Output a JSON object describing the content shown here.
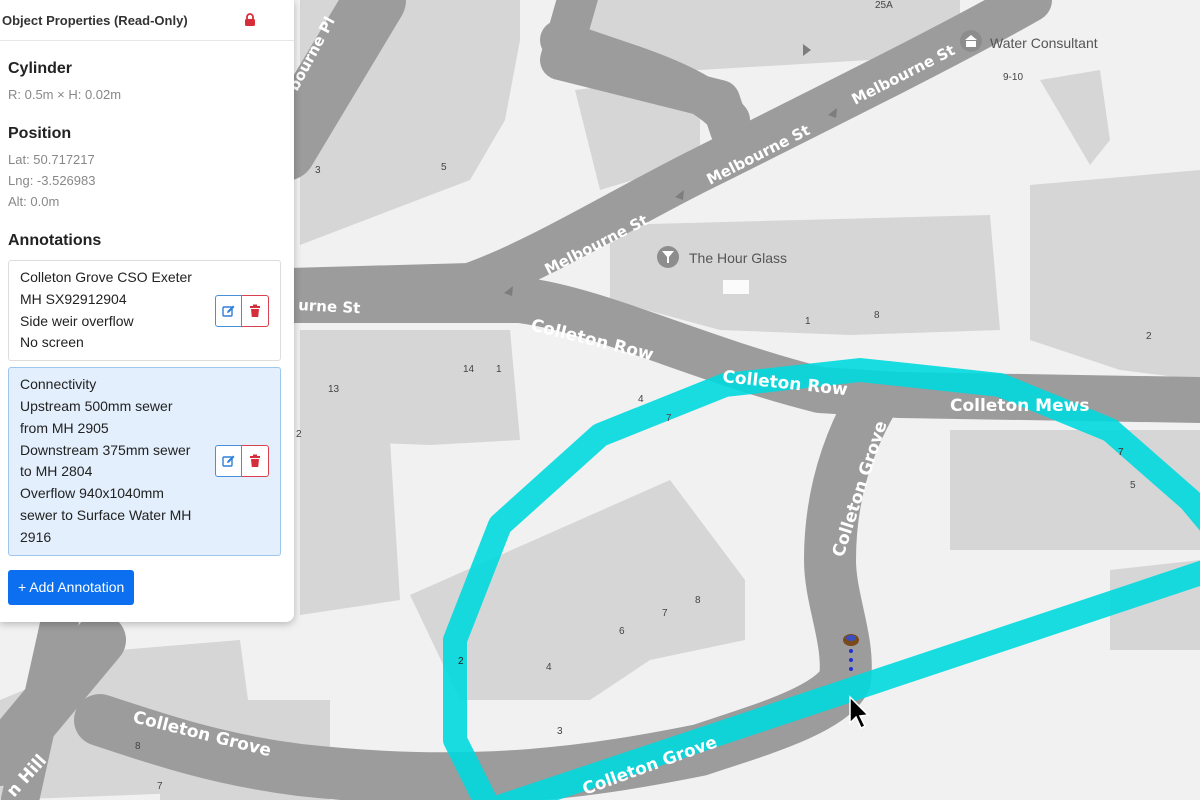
{
  "panel": {
    "title": "Object Properties (Read-Only)",
    "lock_icon": "lock-icon",
    "shape": {
      "heading": "Cylinder",
      "dimensions": "R: 0.5m × H: 0.02m"
    },
    "position": {
      "heading": "Position",
      "lat": "Lat: 50.717217",
      "lng": "Lng: -3.526983",
      "alt": "Alt: 0.0m"
    },
    "annotations_heading": "Annotations",
    "annotations": [
      {
        "lines": [
          "Colleton Grove CSO Exeter",
          "MH SX92912904",
          "Side weir overflow",
          "No screen"
        ]
      },
      {
        "lines": [
          "Connectivity",
          "Upstream 500mm sewer",
          "from MH 2905",
          "Downstream 375mm sewer",
          "to MH 2804",
          "Overflow 940x1040mm",
          "sewer to Surface Water MH",
          "2916"
        ]
      }
    ],
    "add_button": "+ Add Annotation",
    "colors": {
      "accent": "#0b6ff0",
      "danger": "#d9414f",
      "selected_bg": "#e3effc"
    }
  },
  "map": {
    "roads": {
      "melbourne_pl": "bourne Pl",
      "melbourne_st_1": "Melbourne St",
      "melbourne_st_2": "Melbourne St",
      "melbourne_st_3": "Melbourne St",
      "melbourne_st_4": "urne St",
      "colleton_row_1": "Colleton Row",
      "colleton_row_2": "Colleton Row",
      "colleton_mews": "Colleton Mews",
      "colleton_grove_1": "Colleton Grove",
      "colleton_grove_2": "Colleton Grove",
      "colleton_grove_3": "Colleton Grove",
      "hill": "n Hill"
    },
    "pois": [
      {
        "name": "Water Consultant",
        "icon": "bank-icon"
      },
      {
        "name": "The Hour Glass",
        "icon": "cocktail-icon"
      }
    ],
    "house_numbers": [
      "25A",
      "9-10",
      "3",
      "5",
      "1",
      "8",
      "2",
      "14",
      "1",
      "13",
      "4",
      "7",
      "7",
      "5",
      "2",
      "8",
      "7",
      "6",
      "4",
      "3",
      "8",
      "7"
    ],
    "circle_labels": [
      "2",
      "7"
    ],
    "circle_color": "#00d9de"
  }
}
